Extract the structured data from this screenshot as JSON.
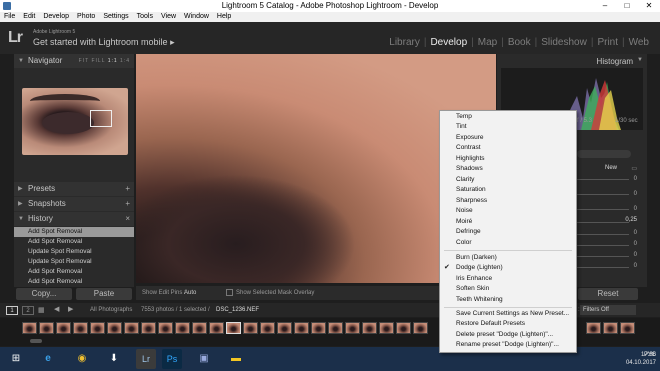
{
  "window": {
    "title": "Lightroom 5 Catalog - Adobe Photoshop Lightroom - Develop",
    "minimize": "–",
    "maximize": "□",
    "close": "✕"
  },
  "menubar": [
    "File",
    "Edit",
    "Develop",
    "Photo",
    "Settings",
    "Tools",
    "View",
    "Window",
    "Help"
  ],
  "identity": {
    "logo": "Lr",
    "product": "Adobe Lightroom 5",
    "mobile": "Get started with Lightroom mobile",
    "arrow": "▸"
  },
  "modules": [
    "Library",
    "Develop",
    "Map",
    "Book",
    "Slideshow",
    "Print",
    "Web"
  ],
  "active_module": "Develop",
  "left": {
    "navigator": {
      "title": "Navigator",
      "options": [
        "FIT",
        "FILL",
        "1:1",
        "1:4"
      ]
    },
    "presets": "Presets",
    "snapshots": "Snapshots",
    "history": {
      "title": "History",
      "items": [
        "Add Spot Removal",
        "Add Spot Removal",
        "Update Spot Removal",
        "Update Spot Removal",
        "Add Spot Removal",
        "Add Spot Removal"
      ]
    },
    "copy_button": "Copy...",
    "paste_button": "Paste"
  },
  "toolbar": {
    "edit_pins_label": "Show Edit Pins :",
    "edit_pins_value": "Auto",
    "mask_overlay": "Show Selected Mask Overlay"
  },
  "right": {
    "histogram_title": "Histogram",
    "f_stop": "f / 5.3",
    "shutter": "1/30 sec",
    "new_label": "New",
    "value_label": "0,25",
    "zeros": [
      "0",
      "0",
      "0",
      "0",
      "0",
      "0",
      "0"
    ],
    "reset_button": "Reset"
  },
  "filmstrip": {
    "pages": [
      "1",
      "2"
    ],
    "source": "All Photographs",
    "count": "7553 photos / 1 selected /",
    "filename": "DSC_1236.NEF",
    "filter_label": "Filter :",
    "filter_value": "Filters Off"
  },
  "context_menu": {
    "group1": [
      "Temp",
      "Tint",
      "Exposure",
      "Contrast",
      "Highlights",
      "Shadows",
      "Clarity",
      "Saturation",
      "Sharpness",
      "Noise",
      "Moiré",
      "Defringe",
      "Color"
    ],
    "group2": [
      "Burn (Darken)",
      "Dodge (Lighten)",
      "Iris Enhance",
      "Soften Skin",
      "Teeth Whitening"
    ],
    "checked": "Dodge (Lighten)",
    "group3": [
      "Save Current Settings as New Preset...",
      "Restore Default Presets",
      "Delete preset \"Dodge (Lighten)\"...",
      "Rename preset \"Dodge (Lighten)\"..."
    ]
  },
  "taskbar": {
    "lang": "РУС",
    "time": "17:36",
    "date": "04.10.2017",
    "apps": [
      "Lr",
      "Ps"
    ]
  }
}
